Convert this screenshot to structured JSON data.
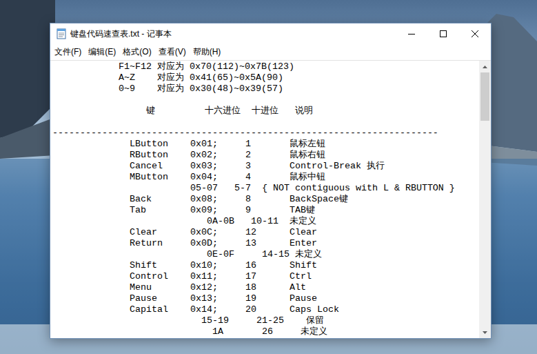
{
  "window": {
    "title": "键盘代码速查表.txt - 记事本"
  },
  "menu": [
    "文件(F)",
    "编辑(E)",
    "格式(O)",
    "查看(V)",
    "帮助(H)"
  ],
  "content": {
    "lines": [
      "            F1~F12 对应为 0x70(112)~0x7B(123)",
      "            A~Z    对应为 0x41(65)~0x5A(90)",
      "            0~9    对应为 0x30(48)~0x39(57)",
      "",
      "                 键         十六进位  十进位   说明",
      "",
      "----------------------------------------------------------------------",
      "              LButton    0x01;     1       鼠标左钮",
      "              RButton    0x02;     2       鼠标右钮",
      "              Cancel     0x03;     3       Control-Break 执行",
      "              MButton    0x04;     4       鼠标中钮",
      "                         05-07   5-7  { NOT contiguous with L & RBUTTON }",
      "              Back       0x08;     8       BackSpace键",
      "              Tab        0x09;     9       TAB键",
      "                            0A-0B   10-11  未定义",
      "              Clear      0x0C;     12      Clear",
      "              Return     0x0D;     13      Enter",
      "                            0E-0F     14-15 未定义",
      "              Shift      0x10;     16      Shift",
      "              Control    0x11;     17      Ctrl",
      "              Menu       0x12;     18      Alt",
      "              Pause      0x13;     19      Pause",
      "              Capital    0x14;     20      Caps Lock",
      "                           15-19     21-25    保留",
      "                             1A       26     未定义"
    ]
  },
  "scrollbar": {
    "offset": 0.0,
    "span": 0.19
  }
}
